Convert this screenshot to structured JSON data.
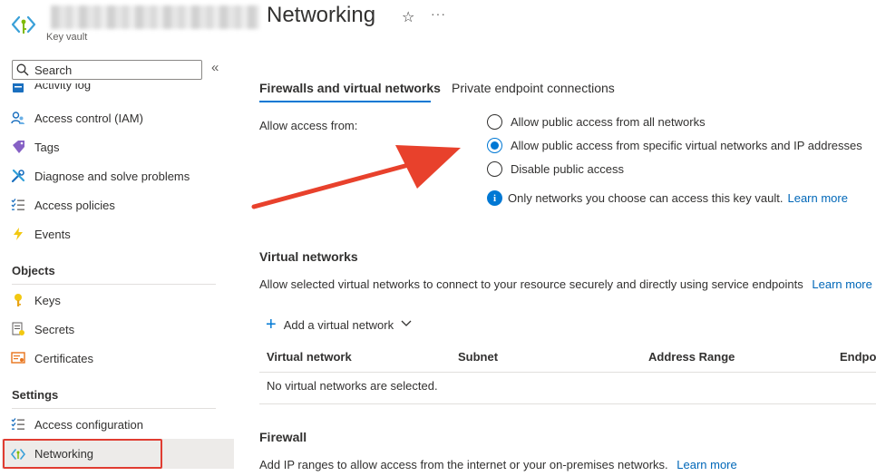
{
  "header": {
    "resource_type": "Key vault",
    "page_title": "Networking",
    "favorite_icon": "star-icon",
    "more_icon": "ellipsis-icon"
  },
  "sidebar": {
    "search": {
      "placeholder": "Search",
      "value": ""
    },
    "items_top": [
      {
        "label": "Activity log",
        "icon": "activity-log-icon"
      },
      {
        "label": "Access control (IAM)",
        "icon": "people-icon"
      },
      {
        "label": "Tags",
        "icon": "tag-icon"
      },
      {
        "label": "Diagnose and solve problems",
        "icon": "wrench-icon"
      },
      {
        "label": "Access policies",
        "icon": "list-check-icon"
      },
      {
        "label": "Events",
        "icon": "lightning-icon"
      }
    ],
    "sections": [
      {
        "title": "Objects",
        "items": [
          {
            "label": "Keys",
            "icon": "key-icon"
          },
          {
            "label": "Secrets",
            "icon": "secret-icon"
          },
          {
            "label": "Certificates",
            "icon": "certificate-icon"
          }
        ]
      },
      {
        "title": "Settings",
        "items": [
          {
            "label": "Access configuration",
            "icon": "list-check-icon"
          },
          {
            "label": "Networking",
            "icon": "networking-icon",
            "selected": true
          }
        ]
      }
    ]
  },
  "tabs": [
    {
      "label": "Firewalls and virtual networks",
      "active": true
    },
    {
      "label": "Private endpoint connections",
      "active": false
    }
  ],
  "firewall_settings": {
    "allow_access_label": "Allow access from:",
    "options": [
      {
        "label": "Allow public access from all networks",
        "selected": false
      },
      {
        "label": "Allow public access from specific virtual networks and IP addresses",
        "selected": true
      },
      {
        "label": "Disable public access",
        "selected": false
      }
    ],
    "info_text": "Only networks you choose can access this key vault.",
    "info_link": "Learn more"
  },
  "virtual_networks": {
    "title": "Virtual networks",
    "description": "Allow selected virtual networks to connect to your resource securely and directly using service endpoints",
    "learn_more": "Learn more",
    "add_label": "Add a virtual network",
    "columns": [
      "Virtual network",
      "Subnet",
      "Address Range",
      "Endpoi"
    ],
    "empty_message": "No virtual networks are selected."
  },
  "firewall": {
    "title": "Firewall",
    "description": "Add IP ranges to allow access from the internet or your on-premises networks.",
    "learn_more": "Learn more"
  },
  "colors": {
    "accent": "#0078d4",
    "link": "#0067b8",
    "annotation": "#e8412c",
    "selected_bg": "#edebe9"
  }
}
